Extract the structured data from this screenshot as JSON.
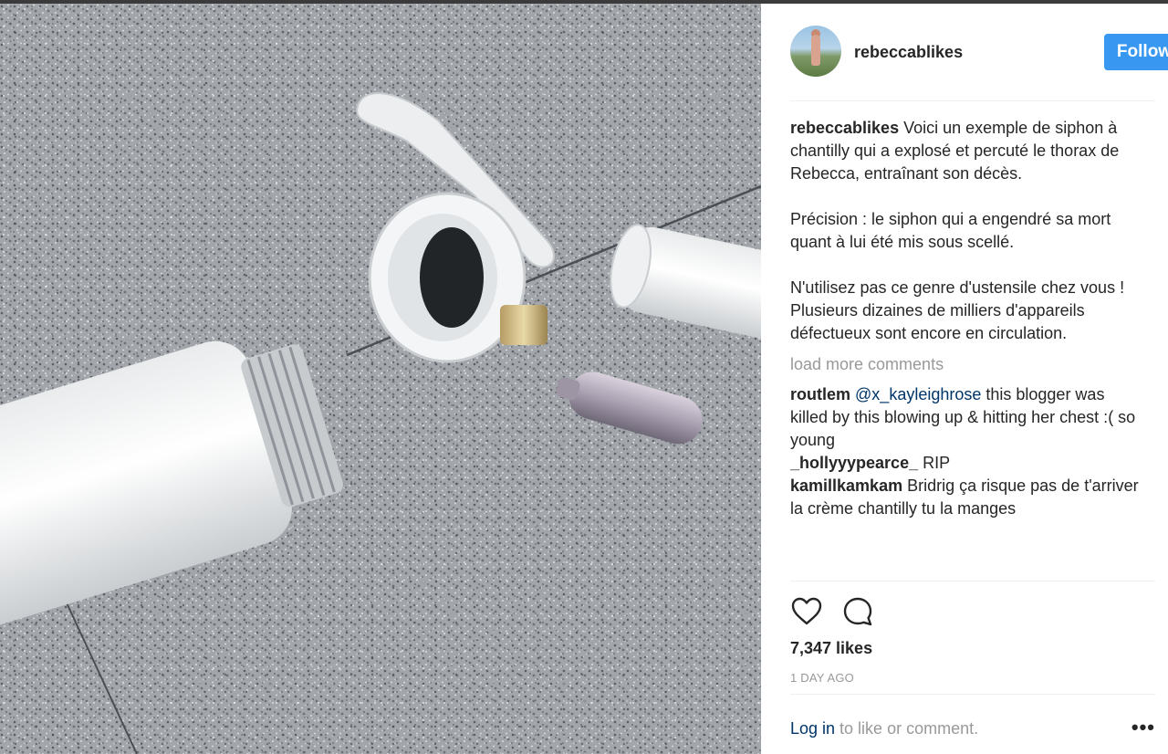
{
  "post": {
    "username": "rebeccablikes",
    "follow_label": "Follow",
    "caption_user": "rebeccablikes",
    "caption_text": "Voici un exemple de siphon à chantilly qui a explosé et percuté le thorax de Rebecca, entraînant son décès.",
    "caption_para2": "Précision : le siphon qui a engendré sa mort quant à lui été mis sous scellé.",
    "caption_para3": "N'utilisez pas ce genre d'ustensile chez vous ! Plusieurs dizaines de milliers d'appareils défectueux sont encore en circulation.",
    "load_more": "load more comments",
    "comments": [
      {
        "user": "routlem",
        "mention": "@x_kayleighrose",
        "text": " this blogger was killed by this blowing up & hitting her chest :( so young"
      },
      {
        "user": "_hollyyypearce_",
        "text": " RIP"
      },
      {
        "user": "kamillkamkam",
        "text": " Bridrig ça risque pas de t'arriver la crème chantilly tu la manges"
      }
    ],
    "likes": "7,347 likes",
    "time": "1 DAY AGO",
    "login_link": "Log in",
    "login_rest": " to like or comment.",
    "more_label": "•••"
  },
  "icons": {
    "like": "heart-icon",
    "comment": "comment-icon"
  },
  "colors": {
    "follow_button": "#3897f0",
    "link": "#003569",
    "muted": "#999999",
    "text": "#262626"
  }
}
